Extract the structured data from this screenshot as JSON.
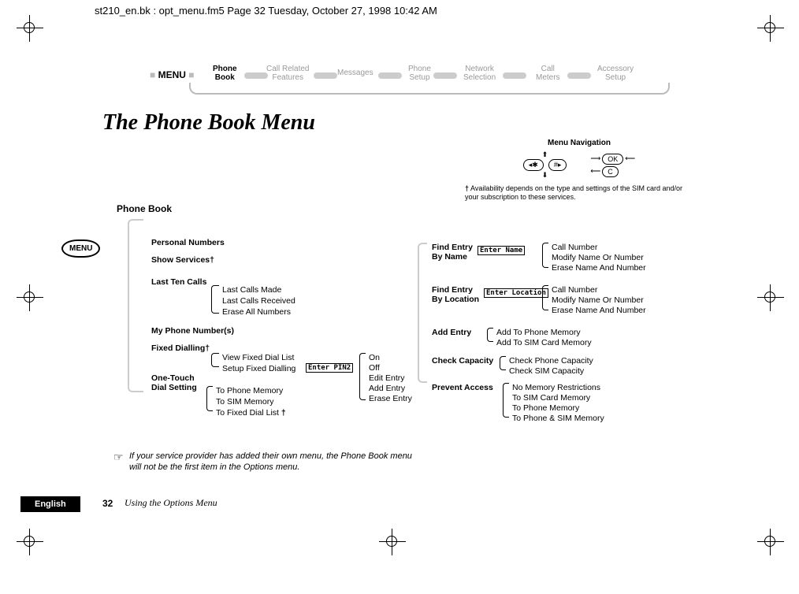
{
  "header_line": "st210_en.bk : opt_menu.fm5  Page 32  Tuesday, October 27, 1998  10:42 AM",
  "menu_label": "MENU",
  "tabs": {
    "t1a": "Phone",
    "t1b": "Book",
    "t2a": "Call Related",
    "t2b": "Features",
    "t3": "Messages",
    "t4a": "Phone",
    "t4b": "Setup",
    "t5a": "Network",
    "t5b": "Selection",
    "t6a": "Call",
    "t6b": "Meters",
    "t7a": "Accessory",
    "t7b": "Setup"
  },
  "title": "The Phone Book Menu",
  "nav": {
    "title": "Menu Navigation",
    "btn_left": "◂✱",
    "btn_right": "#▸",
    "btn_ok": "OK",
    "btn_c": "C",
    "note": "Availability depends on the type and settings of the SIM card and/or your subscription to these services.",
    "dagger": "†"
  },
  "menu_button": "MENU",
  "tree": {
    "root": "Phone Book",
    "n1": "Personal Numbers",
    "n2": "Show Services",
    "n3": "Last Ten Calls",
    "n3a": "Last Calls Made",
    "n3b": "Last Calls Received",
    "n3c": "Erase All Numbers",
    "n4": "My Phone Number(s)",
    "n5": "Fixed Dialling",
    "n5a": "View Fixed Dial List",
    "n5b": "Setup Fixed Dialling",
    "n5b_in": "Enter PIN2",
    "n5b1": "On",
    "n5b2": "Off",
    "n5b3": "Edit Entry",
    "n5b4": "Add Entry",
    "n5b5": "Erase Entry",
    "n6a": "One-Touch",
    "n6b": "Dial Setting",
    "n6_1": "To Phone Memory",
    "n6_2": "To SIM Memory",
    "n6_3": "To Fixed Dial List",
    "r1a": "Find Entry",
    "r1b": "By Name",
    "r1_in": "Enter Name",
    "r1_1": "Call Number",
    "r1_2": "Modify Name Or Number",
    "r1_3": "Erase Name And Number",
    "r2a": "Find Entry",
    "r2b": "By Location",
    "r2_in": "Enter Location",
    "r2_1": "Call Number",
    "r2_2": "Modify Name Or Number",
    "r2_3": "Erase Name And Number",
    "r3": "Add Entry",
    "r3_1": "Add To Phone Memory",
    "r3_2": "Add To SIM Card Memory",
    "r4": "Check Capacity",
    "r4_1": "Check Phone Capacity",
    "r4_2": "Check SIM Capacity",
    "r5": "Prevent Access",
    "r5_1": "No Memory Restrictions",
    "r5_2": "To SIM Card Memory",
    "r5_3": "To Phone Memory",
    "r5_4": "To Phone & SIM Memory",
    "dagger": "†"
  },
  "note_icon": "☞",
  "note": "If your service provider has added their own menu, the Phone Book menu will not be the first item in the Options menu.",
  "footer": {
    "lang": "English",
    "page": "32",
    "chapter": "Using the Options Menu"
  }
}
